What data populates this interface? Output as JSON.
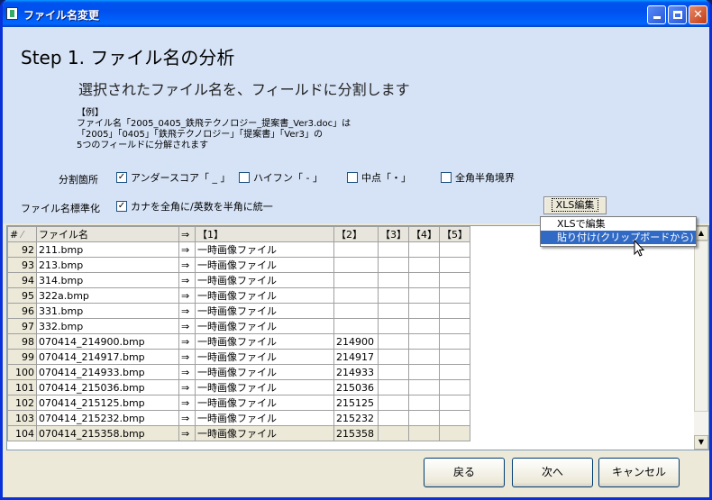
{
  "window": {
    "title": "ファイル名変更"
  },
  "header": {
    "step_title": "Step 1. ファイル名の分析",
    "subtitle": "選択されたファイル名を、フィールドに分割します",
    "example_lines": [
      "【例】",
      "ファイル名「2005_0405_鉄飛テクノロジー_提案書_Ver3.doc」は",
      "「2005」「0405」「鉄飛テクノロジー」「提案書」「Ver3」の",
      "5つのフィールドに分解されます"
    ]
  },
  "split": {
    "label": "分割箇所",
    "options": [
      {
        "label": "アンダースコア「 _ 」",
        "checked": true
      },
      {
        "label": "ハイフン「 - 」",
        "checked": false
      },
      {
        "label": "中点「・」",
        "checked": false
      },
      {
        "label": "全角半角境界",
        "checked": false
      }
    ]
  },
  "normalize": {
    "label": "ファイル名標準化",
    "option": {
      "label": "カナを全角に/英数を半角に統一",
      "checked": true
    }
  },
  "xls_button": {
    "label": "XLS編集"
  },
  "context_menu": {
    "items": [
      {
        "label": "XLSで編集",
        "selected": false
      },
      {
        "label": "貼り付け(クリップボードから)",
        "selected": true
      }
    ]
  },
  "grid": {
    "headers": [
      "#",
      "ファイル名",
      "⇒",
      "【1】",
      "【2】",
      "【3】",
      "【4】",
      "【5】"
    ],
    "rows": [
      [
        "92",
        "211.bmp",
        "⇒",
        "一時画像ファイル",
        "",
        "",
        "",
        ""
      ],
      [
        "93",
        "213.bmp",
        "⇒",
        "一時画像ファイル",
        "",
        "",
        "",
        ""
      ],
      [
        "94",
        "314.bmp",
        "⇒",
        "一時画像ファイル",
        "",
        "",
        "",
        ""
      ],
      [
        "95",
        "322a.bmp",
        "⇒",
        "一時画像ファイル",
        "",
        "",
        "",
        ""
      ],
      [
        "96",
        "331.bmp",
        "⇒",
        "一時画像ファイル",
        "",
        "",
        "",
        ""
      ],
      [
        "97",
        "332.bmp",
        "⇒",
        "一時画像ファイル",
        "",
        "",
        "",
        ""
      ],
      [
        "98",
        "070414_214900.bmp",
        "⇒",
        "一時画像ファイル",
        "214900",
        "",
        "",
        ""
      ],
      [
        "99",
        "070414_214917.bmp",
        "⇒",
        "一時画像ファイル",
        "214917",
        "",
        "",
        ""
      ],
      [
        "100",
        "070414_214933.bmp",
        "⇒",
        "一時画像ファイル",
        "214933",
        "",
        "",
        ""
      ],
      [
        "101",
        "070414_215036.bmp",
        "⇒",
        "一時画像ファイル",
        "215036",
        "",
        "",
        ""
      ],
      [
        "102",
        "070414_215125.bmp",
        "⇒",
        "一時画像ファイル",
        "215125",
        "",
        "",
        ""
      ],
      [
        "103",
        "070414_215232.bmp",
        "⇒",
        "一時画像ファイル",
        "215232",
        "",
        "",
        ""
      ],
      [
        "104",
        "070414_215358.bmp",
        "⇒",
        "一時画像ファイル",
        "215358",
        "",
        "",
        ""
      ]
    ]
  },
  "footer": {
    "back": "戻る",
    "next": "次へ",
    "cancel": "キャンセル"
  }
}
